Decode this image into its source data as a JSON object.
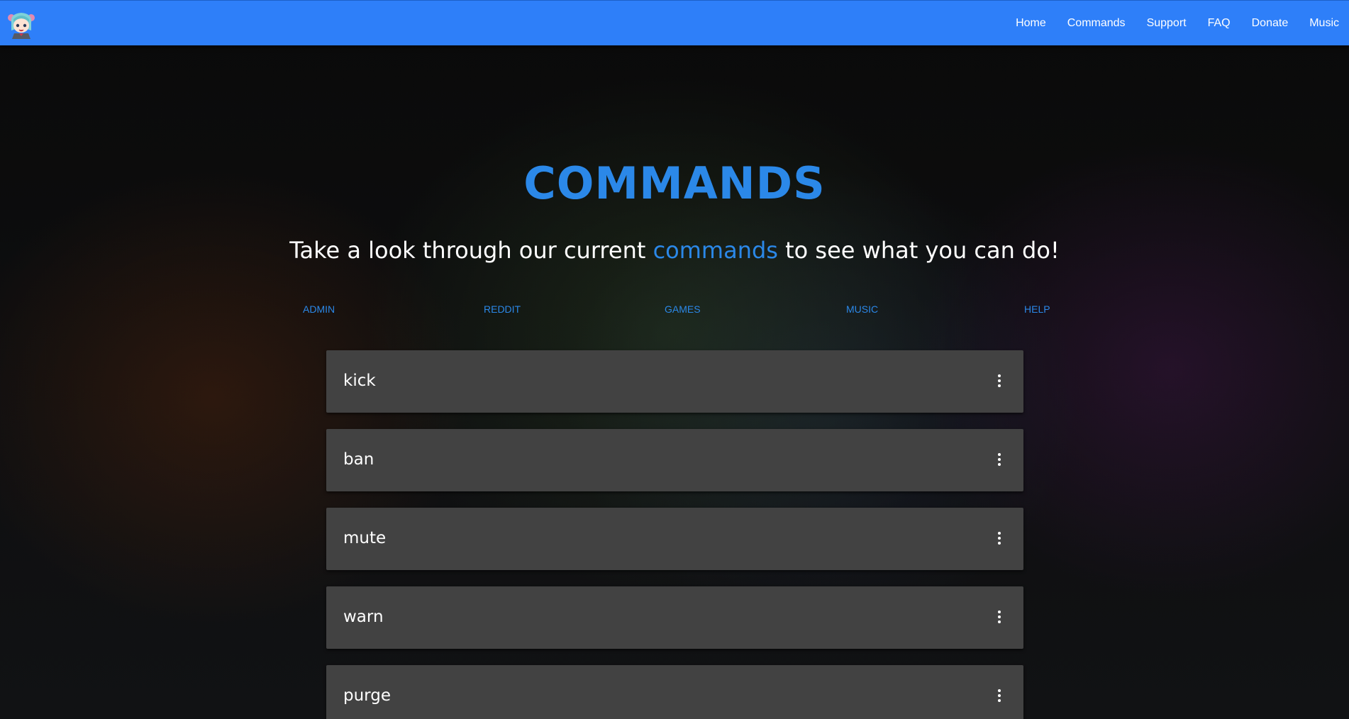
{
  "navbar": {
    "logo_icon": "anime-mascot-logo-icon",
    "links": [
      "Home",
      "Commands",
      "Support",
      "FAQ",
      "Donate",
      "Music"
    ],
    "background_color": "#2e7ff9"
  },
  "hero": {
    "title": "COMMANDS",
    "subtitle_before": "Take a look through our current ",
    "subtitle_highlight": "commands",
    "subtitle_after": " to see what you can do!",
    "accent_color": "#2b88e8"
  },
  "categories": [
    "ADMIN",
    "REDDIT",
    "GAMES",
    "MUSIC",
    "HELP"
  ],
  "commands": [
    {
      "name": "kick",
      "menu_icon": "more-vertical-icon"
    },
    {
      "name": "ban",
      "menu_icon": "more-vertical-icon"
    },
    {
      "name": "mute",
      "menu_icon": "more-vertical-icon"
    },
    {
      "name": "warn",
      "menu_icon": "more-vertical-icon"
    },
    {
      "name": "purge",
      "menu_icon": "more-vertical-icon"
    }
  ]
}
